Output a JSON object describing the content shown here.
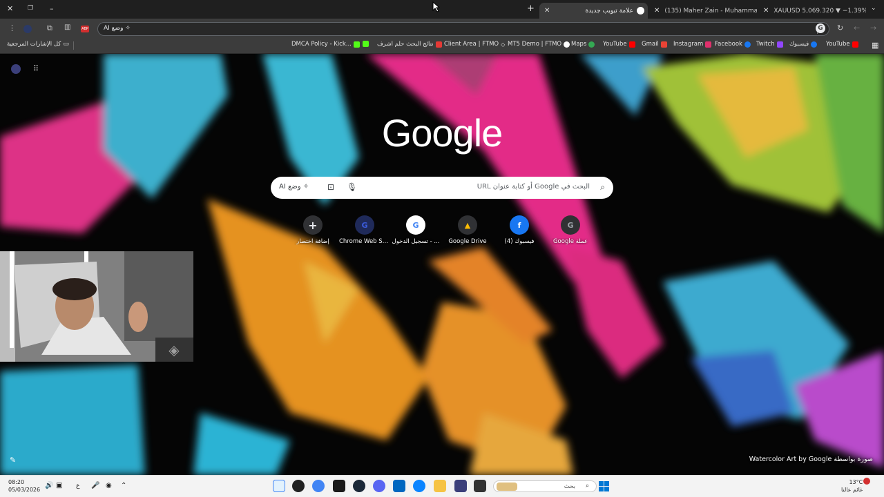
{
  "tabs": [
    {
      "title": "XAUUSD 5,069.320 ▼ −1.39% U...",
      "favicon_color": "#131722"
    },
    {
      "title": "(135) Maher Zain - Muhammad...",
      "favicon_color": "#ff0000"
    },
    {
      "title": "علامة تبويب جديدة",
      "favicon_color": "#ffffff",
      "active": true
    }
  ],
  "new_tab_symbol": "+",
  "omnibox": {
    "ai_chip": "AI وضع"
  },
  "bookmarks": {
    "all_bookmarks": "كل الإشارات المرجعية",
    "items": [
      {
        "label": "YouTube",
        "color": "#ff0000"
      },
      {
        "label": "فيسبوك",
        "color": "#1877f2"
      },
      {
        "label": "Twitch",
        "color": "#9146ff"
      },
      {
        "label": "Facebook",
        "color": "#1877f2"
      },
      {
        "label": "Instagram",
        "color": "#e1306c"
      },
      {
        "label": "Gmail",
        "color": "#ea4335"
      },
      {
        "label": "YouTube",
        "color": "#ff0000"
      },
      {
        "label": "Maps",
        "color": "#34a853"
      },
      {
        "label": "MT5 Demo | FTMO",
        "color": "#ffffff"
      },
      {
        "label": "Client Area | FTMO",
        "color": "#ffffff"
      },
      {
        "label": "نتائج البحث حلم اشرف",
        "color": "#e53935"
      },
      {
        "label": "",
        "color": "#53fc18"
      },
      {
        "label": "DMCA Policy - Kick...",
        "color": "#53fc18"
      }
    ]
  },
  "google": {
    "logo": "Google",
    "search_placeholder": "البحث في Google أو كتابة عنوان URL",
    "ai_mode": "AI وضع"
  },
  "shortcuts": [
    {
      "label": "إضافة اختصار",
      "glyph": "+",
      "color": "#e8eaed"
    },
    {
      "label": "Chrome Web St...",
      "glyph": "G",
      "color": "#3b5bdb"
    },
    {
      "label": "تسجيل الدخول - ...",
      "glyph": "G",
      "color": "#4285f4"
    },
    {
      "label": "Google Drive",
      "glyph": "▲",
      "color": "#fbbc04"
    },
    {
      "label": "فيسبوك (4)",
      "glyph": "f",
      "color": "#1877f2"
    },
    {
      "label": "Google عملة",
      "glyph": "G",
      "color": "#9aa0a6"
    }
  ],
  "credit": "Watercolor Art by Google صورة بواسطة",
  "taskbar": {
    "time": "08:20",
    "date": "05/03/2026",
    "lang": "ع",
    "search_label": "بحث",
    "weather_temp": "13°C",
    "weather_desc": "غائم عالنا"
  }
}
